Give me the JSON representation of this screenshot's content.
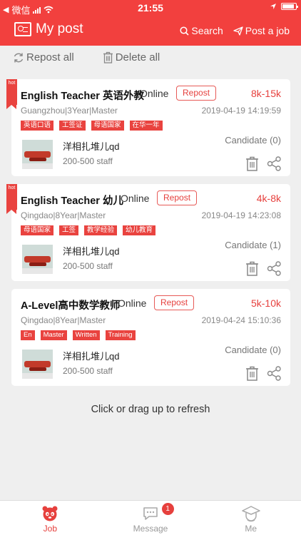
{
  "status_bar": {
    "carrier": "微信",
    "time": "21:55"
  },
  "header": {
    "title": "My post",
    "search_label": "Search",
    "post_label": "Post a job"
  },
  "toolbar": {
    "repost_all": "Repost all",
    "delete_all": "Delete all"
  },
  "hot_label": "hot",
  "repost_label": "Repost",
  "jobs": [
    {
      "hot": true,
      "title": "English Teacher 英语外教",
      "mode": "Online",
      "salary": "8k-15k",
      "meta": "Guangzhou|3Year|Master",
      "date": "2019-04-19 14:19:59",
      "tags": [
        "英语口语",
        "工签证",
        "母语国家",
        "在华一年"
      ],
      "company": "洋相扎堆儿qd",
      "staff": "200-500 staff",
      "candidate": "Candidate (0)"
    },
    {
      "hot": true,
      "title": "English Teacher 幼儿",
      "mode": "Online",
      "salary": "4k-8k",
      "meta": "Qingdao|8Year|Master",
      "date": "2019-04-19 14:23:08",
      "tags": [
        "母语国家",
        "工签",
        "教学经验",
        "幼儿教育"
      ],
      "company": "洋相扎堆儿qd",
      "staff": "200-500 staff",
      "candidate": "Candidate (1)"
    },
    {
      "hot": false,
      "title": "A-Level高中数学教师",
      "mode": "Online",
      "salary": "5k-10k",
      "meta": "Qingdao|8Year|Master",
      "date": "2019-04-24 15:10:36",
      "tags": [
        "En",
        "Master",
        "Written",
        "Training"
      ],
      "company": "洋相扎堆儿qd",
      "staff": "200-500 staff",
      "candidate": "Candidate (0)"
    }
  ],
  "refresh_hint": "Click or drag up to refresh",
  "tabbar": {
    "job": "Job",
    "message": "Message",
    "message_badge": "1",
    "me": "Me"
  },
  "colors": {
    "brand": "#f2403e",
    "accent": "#e6403d"
  },
  "icons": [
    "wechat-back",
    "signal-icon",
    "wifi-icon",
    "location-icon",
    "battery-icon",
    "card-icon",
    "search-icon",
    "send-icon",
    "refresh-icon",
    "trash-icon",
    "share-icon",
    "panda-icon",
    "chat-icon",
    "person-icon"
  ]
}
